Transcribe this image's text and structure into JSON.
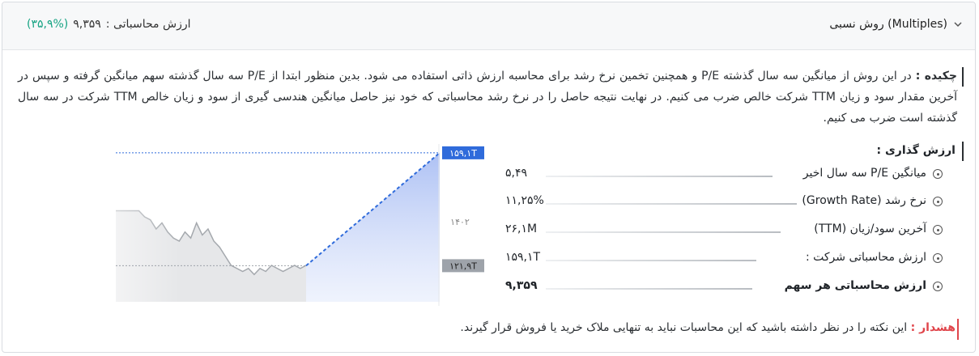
{
  "header": {
    "title": "روش نسبی (Multiples)",
    "value_label": "ارزش محاسباتی :",
    "value": "۹,۳۵۹",
    "change": "(۳۵,۹%)"
  },
  "summary": {
    "label": "چکیده :",
    "text": "در این روش از میانگین سه سال گذشته P/E و همچنین تخمین نرخ رشد برای محاسبه ارزش ذاتی استفاده می شود. بدین منظور ابتدا از P/E سه سال گذشته سهم میانگین گرفته و سپس در آخرین مقدار سود و زیان TTM شرکت خالص ضرب می کنیم. در نهایت نتیجه حاصل را در نرخ رشد محاسباتی که خود نیز حاصل میانگین هندسی گیری از سود و زیان خالص TTM شرکت در سه سال گذشته است ضرب می کنیم."
  },
  "valuation": {
    "title": "ارزش گذاری :",
    "rows": [
      {
        "label": "میانگین P/E سه سال اخیر",
        "value": "۵,۴۹"
      },
      {
        "label": "نرخ رشد (Growth Rate)",
        "value": "۱۱,۲۵%"
      },
      {
        "label": "آخرین سود/زیان (TTM)",
        "value": "۲۶,۱M"
      },
      {
        "label": "ارزش محاسباتی شرکت :",
        "value": "۱۵۹,۱T"
      },
      {
        "label": "ارزش محاسباتی هر سهم",
        "value": "۹,۳۵۹"
      }
    ]
  },
  "chart": {
    "top_tag": "۱۵۹,۱T",
    "bottom_tag": "۱۲۱,۹T",
    "year_label": "۱۴۰۲"
  },
  "chart_data": {
    "type": "line",
    "series": [
      {
        "values": [
          140,
          140,
          140,
          140,
          140,
          138,
          137,
          134,
          136,
          133,
          131,
          130,
          133,
          131,
          136,
          132,
          134,
          130,
          128,
          125,
          122,
          121,
          120,
          121,
          119,
          121,
          120,
          122,
          121,
          120,
          121,
          122,
          121,
          122
        ]
      }
    ],
    "projection": {
      "from": 121.9,
      "to": 159.1
    },
    "ylim": [
      110,
      162
    ],
    "grid": false
  },
  "warning": {
    "label": "هشدار :",
    "text": "این نکته را در نظر داشته باشید که این محاسبات نباید به تنهایی ملاک خرید یا فروش قرار گیرند."
  },
  "colors": {
    "accent": "#2f6bdb",
    "positive": "#16a383",
    "danger": "#e0454b"
  }
}
